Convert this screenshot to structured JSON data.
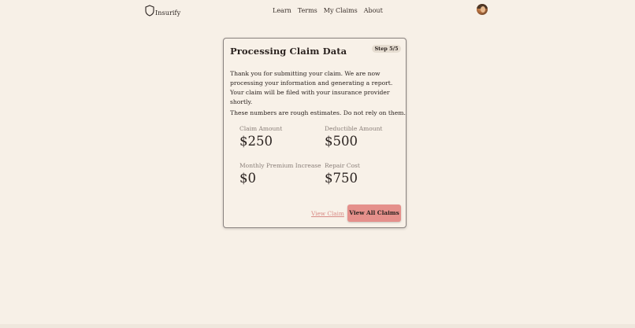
{
  "header": {
    "brand": "Insurify",
    "nav": [
      "Learn",
      "Terms",
      "My Claims",
      "About"
    ]
  },
  "card": {
    "title": "Processing Claim Data",
    "step_badge": "Step 5/5",
    "description": "Thank you for submitting your claim. We are now processing your information and generating a report. Your claim will be filed with your insurance provider shortly.",
    "disclaimer": "These numbers are rough estimates. Do not rely on them.",
    "stats": [
      {
        "label": "Claim Amount",
        "value": "$250"
      },
      {
        "label": "Deductible Amount",
        "value": "$500"
      },
      {
        "label": "Monthly Premium Increase",
        "value": "$0"
      },
      {
        "label": "Repair Cost",
        "value": "$750"
      }
    ],
    "view_claim_link": "View Claim",
    "view_all_button": "View All Claims"
  },
  "colors": {
    "background": "#f7f0e7",
    "accent_button": "#e5908b",
    "link": "#d88b86"
  },
  "icons": {
    "logo": "shield-logo-icon",
    "avatar": "user-avatar"
  }
}
